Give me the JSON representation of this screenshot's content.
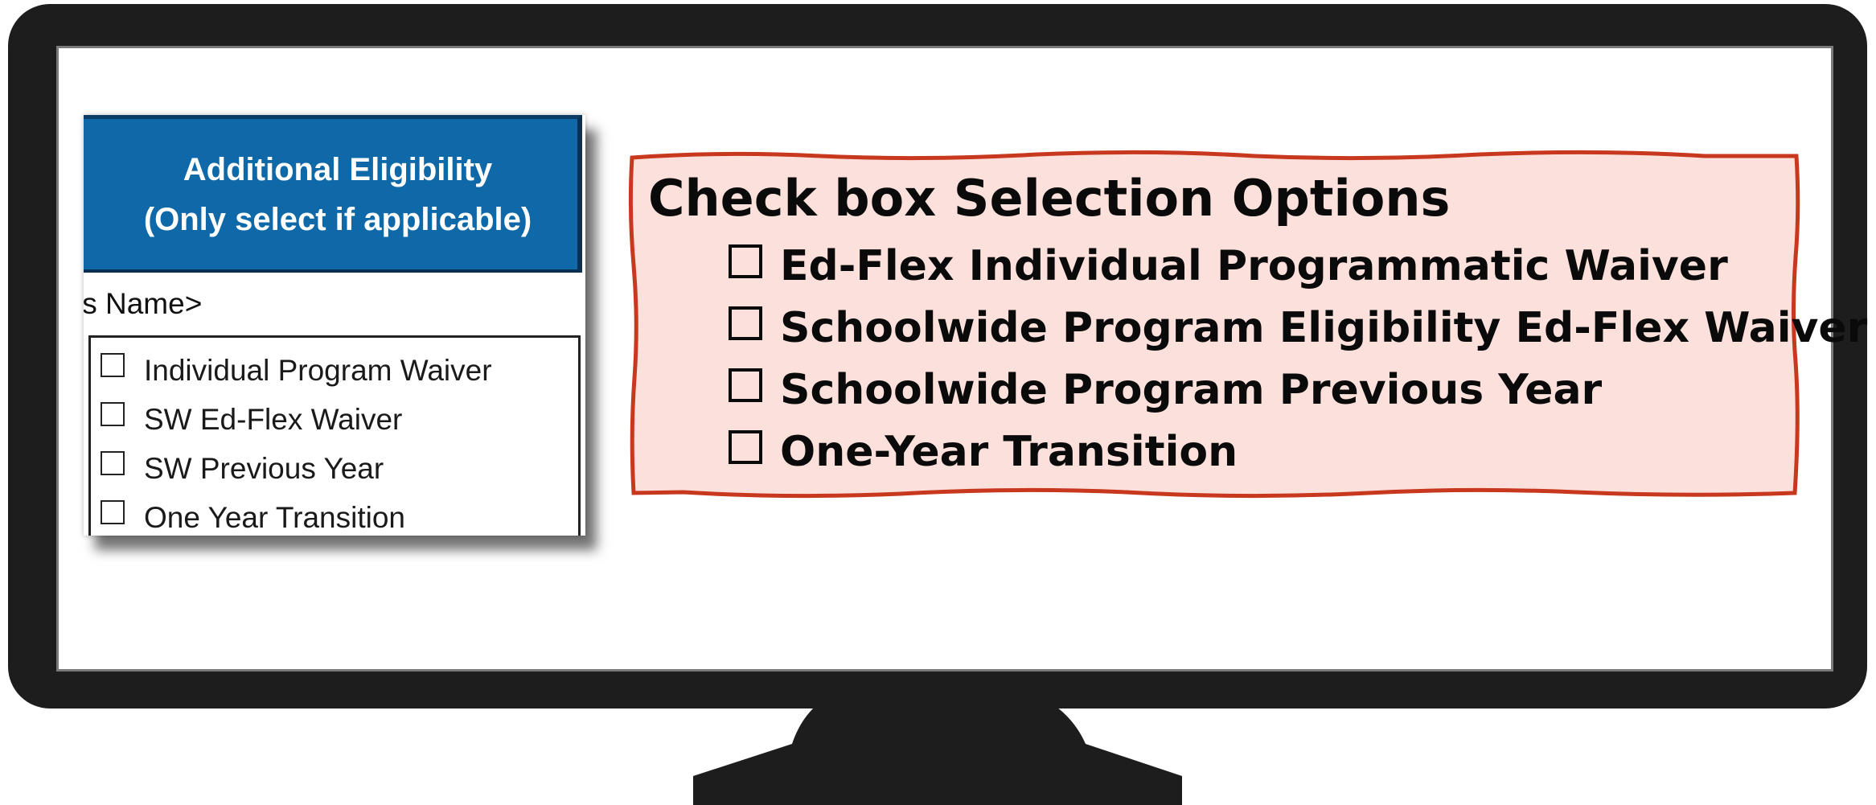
{
  "form_panel": {
    "header_line1": "Additional Eligibility",
    "header_line2": "(Only select if applicable)",
    "name_label": "is Name>",
    "options": [
      {
        "label": "Individual Program Waiver",
        "checked": false
      },
      {
        "label": "SW Ed-Flex Waiver",
        "checked": false
      },
      {
        "label": "SW Previous Year",
        "checked": false
      },
      {
        "label": "One Year Transition",
        "checked": false
      }
    ],
    "header_color": "#0f68a8"
  },
  "callout": {
    "title": "Check box Selection Options",
    "options": [
      {
        "label": "Ed-Flex Individual Programmatic Waiver"
      },
      {
        "label": "Schoolwide Program Eligibility Ed-Flex Waiver"
      },
      {
        "label": "Schoolwide Program Previous Year"
      },
      {
        "label": "One-Year Transition"
      }
    ],
    "fill_color": "#fbe0db",
    "border_color": "#c8381f"
  },
  "colors": {
    "bezel": "#1d1d1d",
    "screen": "#ffffff"
  }
}
